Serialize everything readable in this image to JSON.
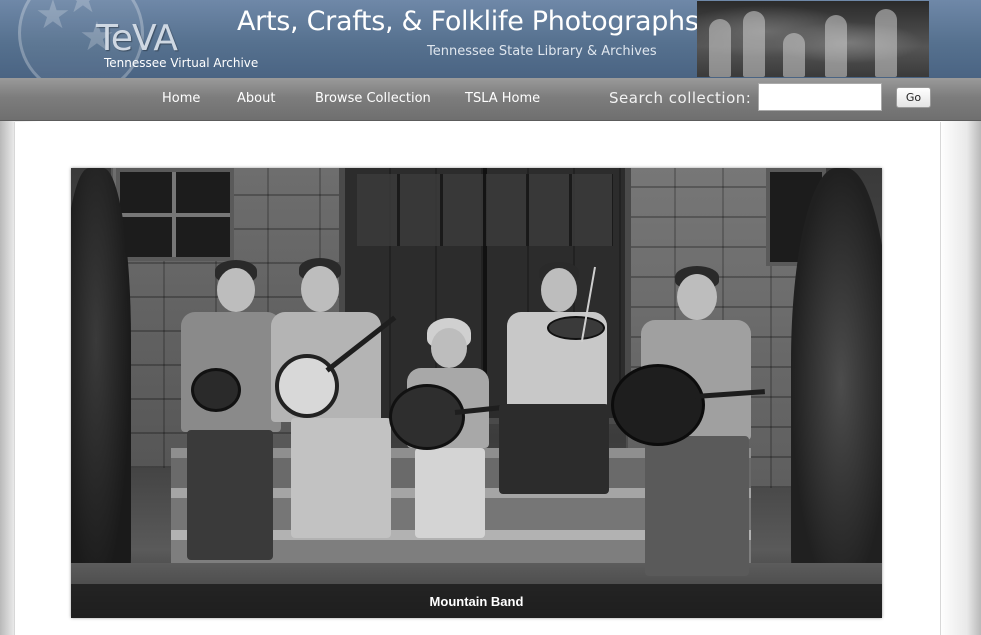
{
  "header": {
    "logo_text": "TeVA",
    "logo_subtitle": "Tennessee Virtual Archive",
    "site_title": "Arts, Crafts, & Folklife Photographs",
    "site_subtitle": "Tennessee State Library & Archives",
    "brand_color": "#5a7393"
  },
  "nav": {
    "items": [
      {
        "label": "Home"
      },
      {
        "label": "About"
      },
      {
        "label": "Browse Collection"
      },
      {
        "label": "TSLA Home"
      }
    ],
    "search_label": "Search collection:",
    "search_value": "",
    "go_label": "Go"
  },
  "feature": {
    "caption": "Mountain Band",
    "image_description_icon": "photo"
  }
}
